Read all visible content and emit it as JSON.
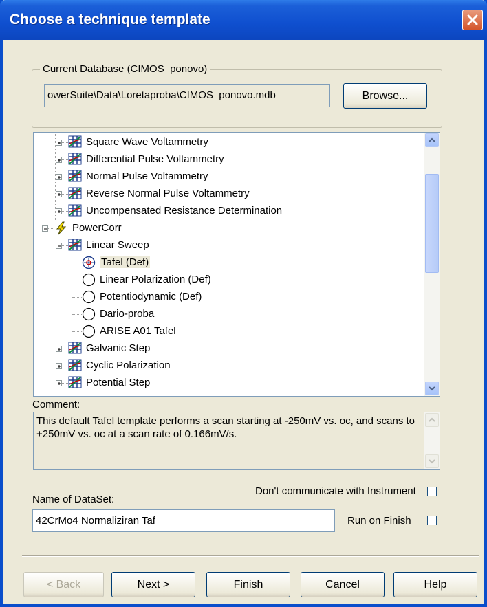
{
  "window": {
    "title": "Choose a technique template",
    "close_icon": "close-icon"
  },
  "database": {
    "group_label": "Current Database (CIMOS_ponovo)",
    "path": "owerSuite\\Data\\Loretaproba\\CIMOS_ponovo.mdb",
    "browse_label": "Browse..."
  },
  "tree": {
    "items": [
      {
        "label": "Square Wave Voltammetry",
        "icon": "technique-icon"
      },
      {
        "label": "Differential Pulse Voltammetry",
        "icon": "technique-icon"
      },
      {
        "label": "Normal Pulse Voltammetry",
        "icon": "technique-icon"
      },
      {
        "label": "Reverse Normal Pulse Voltammetry",
        "icon": "technique-icon"
      },
      {
        "label": "Uncompensated Resistance Determination",
        "icon": "technique-icon"
      },
      {
        "label": "PowerCorr",
        "icon": "lightning-icon"
      },
      {
        "label": "Linear Sweep",
        "icon": "technique-icon"
      },
      {
        "label": "Tafel (Def)",
        "icon": "selected-radio-icon",
        "selected": true
      },
      {
        "label": "Linear Polarization (Def)",
        "icon": "radio-icon"
      },
      {
        "label": "Potentiodynamic (Def)",
        "icon": "radio-icon"
      },
      {
        "label": "Dario-proba",
        "icon": "radio-icon"
      },
      {
        "label": "ARISE A01 Tafel",
        "icon": "radio-icon"
      },
      {
        "label": "Galvanic Step",
        "icon": "technique-icon"
      },
      {
        "label": "Cyclic Polarization",
        "icon": "technique-icon"
      },
      {
        "label": "Potential Step",
        "icon": "technique-icon"
      }
    ]
  },
  "comment": {
    "label": "Comment:",
    "text": "This default Tafel template performs a scan starting at -250mV vs. oc, and scans to +250mV vs. oc at a scan rate of 0.166mV/s."
  },
  "dataset": {
    "label": "Name of DataSet:",
    "value": "42CrMo4 Normaliziran Taf",
    "dont_communicate_label": "Don't communicate with Instrument",
    "dont_communicate_checked": false,
    "run_on_finish_label": "Run on Finish",
    "run_on_finish_checked": false
  },
  "buttons": {
    "back": "< Back",
    "next": "Next >",
    "finish": "Finish",
    "cancel": "Cancel",
    "help": "Help"
  },
  "colors": {
    "title_bar": "#0c46bf",
    "face": "#ece9d8",
    "close": "#d4552c"
  }
}
